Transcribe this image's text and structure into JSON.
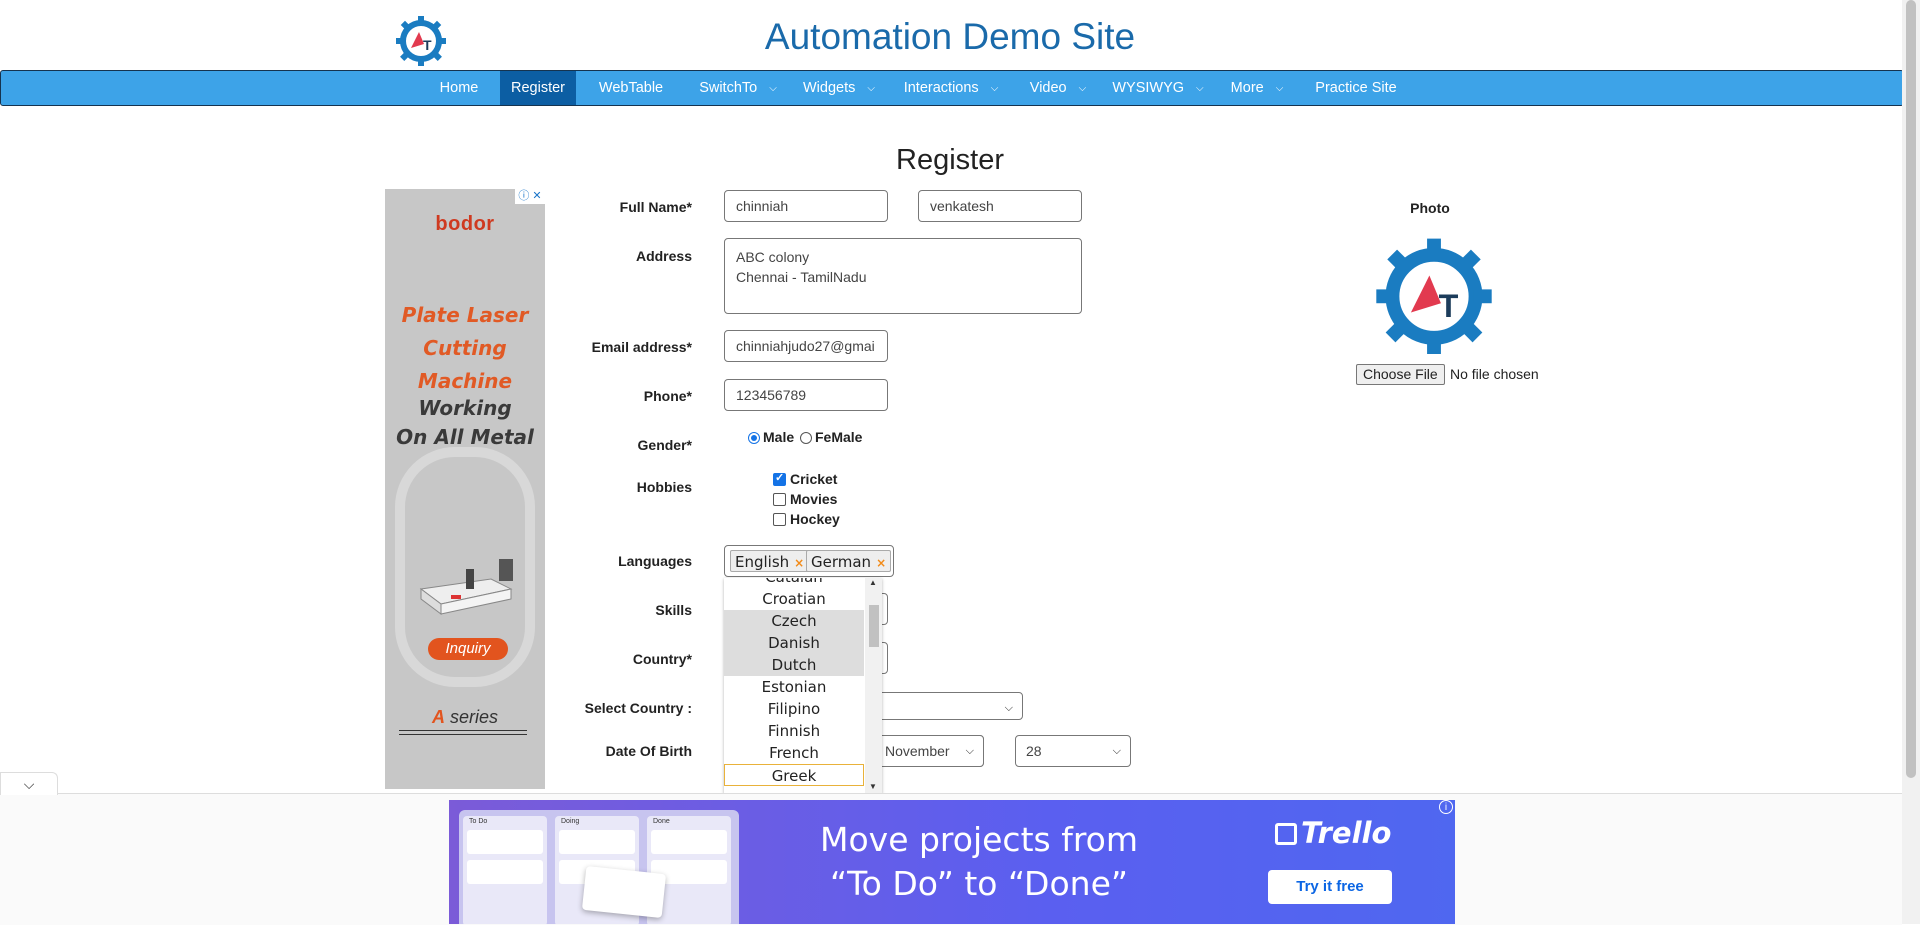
{
  "header": {
    "title": "Automation Demo Site",
    "logo_text": "AT"
  },
  "nav": {
    "items": [
      {
        "label": "Home",
        "active": false,
        "dropdown": false
      },
      {
        "label": "Register",
        "active": true,
        "dropdown": false
      },
      {
        "label": "WebTable",
        "active": false,
        "dropdown": false
      },
      {
        "label": "SwitchTo",
        "active": false,
        "dropdown": true
      },
      {
        "label": "Widgets",
        "active": false,
        "dropdown": true
      },
      {
        "label": "Interactions",
        "active": false,
        "dropdown": true
      },
      {
        "label": "Video",
        "active": false,
        "dropdown": true
      },
      {
        "label": "WYSIWYG",
        "active": false,
        "dropdown": true
      },
      {
        "label": "More",
        "active": false,
        "dropdown": true
      },
      {
        "label": "Practice Site",
        "active": false,
        "dropdown": false
      }
    ]
  },
  "form": {
    "heading": "Register",
    "labels": {
      "full_name": "Full Name*",
      "address": "Address",
      "email": "Email address*",
      "phone": "Phone*",
      "gender": "Gender*",
      "hobbies": "Hobbies",
      "languages": "Languages",
      "skills": "Skills",
      "country": "Country*",
      "select_country": "Select Country :",
      "dob": "Date Of Birth"
    },
    "first_name": "chinniah",
    "last_name": "venkatesh",
    "address": "ABC colony\nChennai - TamilNadu",
    "email": "chinniahjudo27@gmai",
    "phone": "123456789",
    "gender": {
      "options": [
        "Male",
        "FeMale"
      ],
      "selected": "Male"
    },
    "hobbies": [
      {
        "label": "Cricket",
        "checked": true
      },
      {
        "label": "Movies",
        "checked": false
      },
      {
        "label": "Hockey",
        "checked": false
      }
    ],
    "languages": {
      "selected": [
        "English",
        "German"
      ],
      "remove_symbol": "×",
      "list": [
        "Catalan",
        "Croatian",
        "Czech",
        "Danish",
        "Dutch",
        "Estonian",
        "Filipino",
        "Finnish",
        "French",
        "Greek"
      ],
      "highlighted": [
        "Czech",
        "Danish",
        "Dutch"
      ],
      "focused": "Greek"
    },
    "dob": {
      "month": "November",
      "day": "28"
    }
  },
  "photo": {
    "label": "Photo",
    "choose_button": "Choose File",
    "status": "No file chosen"
  },
  "ad_left": {
    "brand": "bodor",
    "line1": [
      "Plate Laser",
      "Cutting",
      "Machine"
    ],
    "line2": [
      "Working",
      "On All Metal"
    ],
    "cta": "Inquiry",
    "series_a": "A",
    "series_rest": " series"
  },
  "ad_bottom": {
    "headline_1": "Move projects from",
    "headline_2": "“To Do” to “Done”",
    "brand": "Trello",
    "cta": "Try it free",
    "columns": [
      "To Do",
      "Doing",
      "Done"
    ]
  },
  "colors": {
    "nav_bg": "#3da3e8",
    "nav_active": "#0c5ea3",
    "title": "#1a6aaa"
  }
}
